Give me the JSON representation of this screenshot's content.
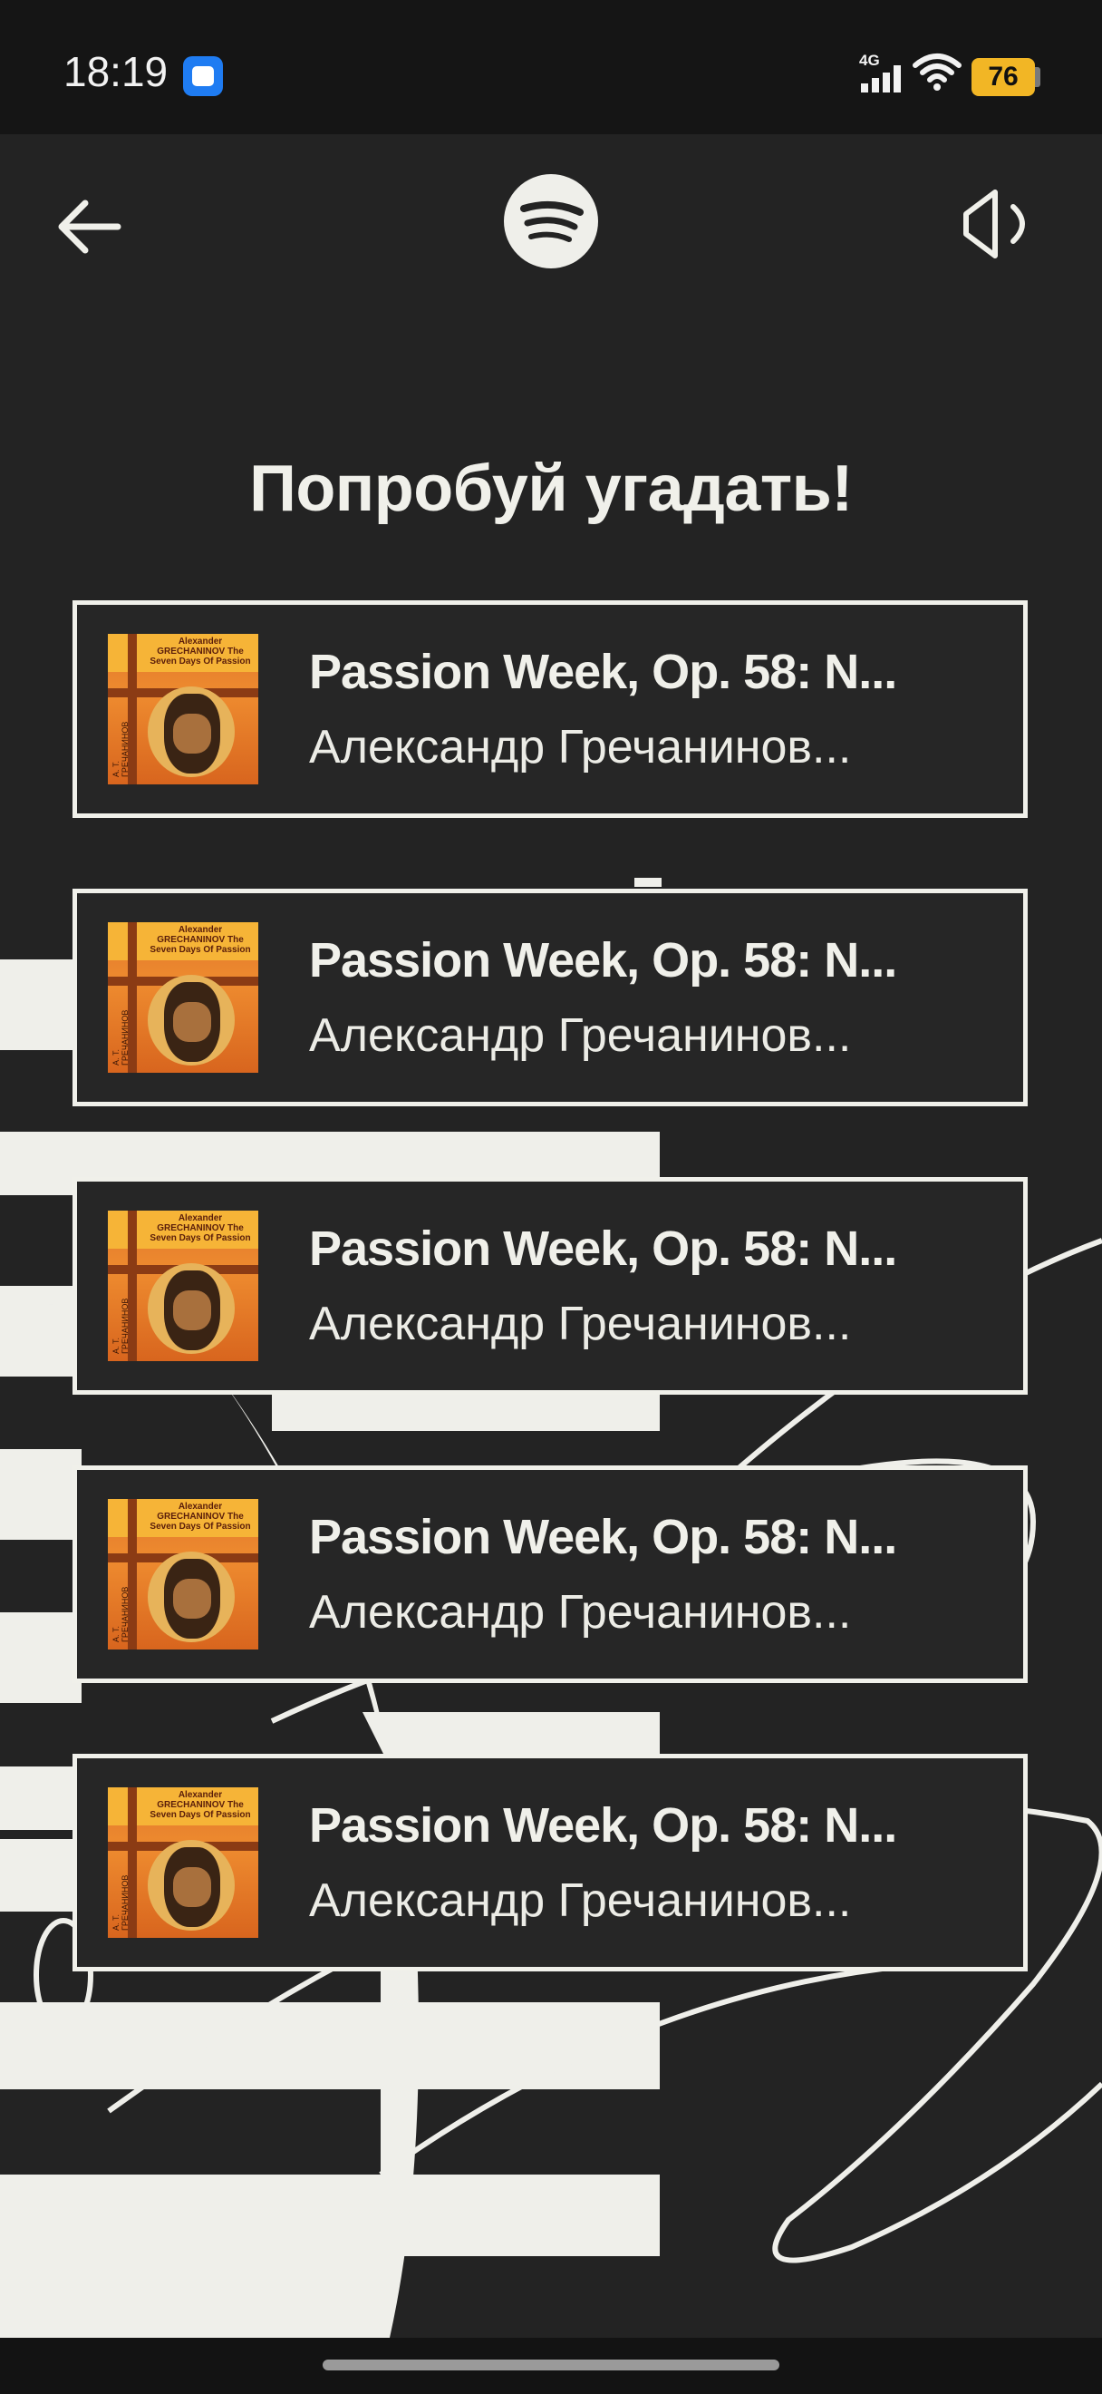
{
  "status_bar": {
    "time": "18:19",
    "network": "4G",
    "battery": "76",
    "notification_icon": "messenger-app-icon"
  },
  "header": {
    "back_icon": "arrow-left-icon",
    "logo_icon": "spotify-logo-icon",
    "sound_icon": "speaker-icon"
  },
  "main": {
    "title": "Попробуй угадать!",
    "options": [
      {
        "track": "Passion Week, Op. 58: N...",
        "artist": "Александр Гречанинов...",
        "cover_text": "Alexander GRECHANINOV The Seven Days Of Passion",
        "cover_side": "А. Т. ГРЕЧАНИНОВ"
      },
      {
        "track": "Passion Week, Op. 58: N...",
        "artist": "Александр Гречанинов...",
        "cover_text": "Alexander GRECHANINOV The Seven Days Of Passion",
        "cover_side": "А. Т. ГРЕЧАНИНОВ"
      },
      {
        "track": "Passion Week, Op. 58: N...",
        "artist": "Александр Гречанинов...",
        "cover_text": "Alexander GRECHANINOV The Seven Days Of Passion",
        "cover_side": "А. Т. ГРЕЧАНИНОВ"
      },
      {
        "track": "Passion Week, Op. 58: N...",
        "artist": "Александр Гречанинов...",
        "cover_text": "Alexander GRECHANINOV The Seven Days Of Passion",
        "cover_side": "А. Т. ГРЕЧАНИНОВ"
      },
      {
        "track": "Passion Week, Op. 58: N...",
        "artist": "Александр Гречанинов...",
        "cover_text": "Alexander GRECHANINOV The Seven Days Of Passion",
        "cover_side": "А. Т. ГРЕЧАНИНОВ"
      }
    ]
  },
  "colors": {
    "background": "#232323",
    "foreground": "#f0f0ea",
    "battery": "#f2b625"
  }
}
